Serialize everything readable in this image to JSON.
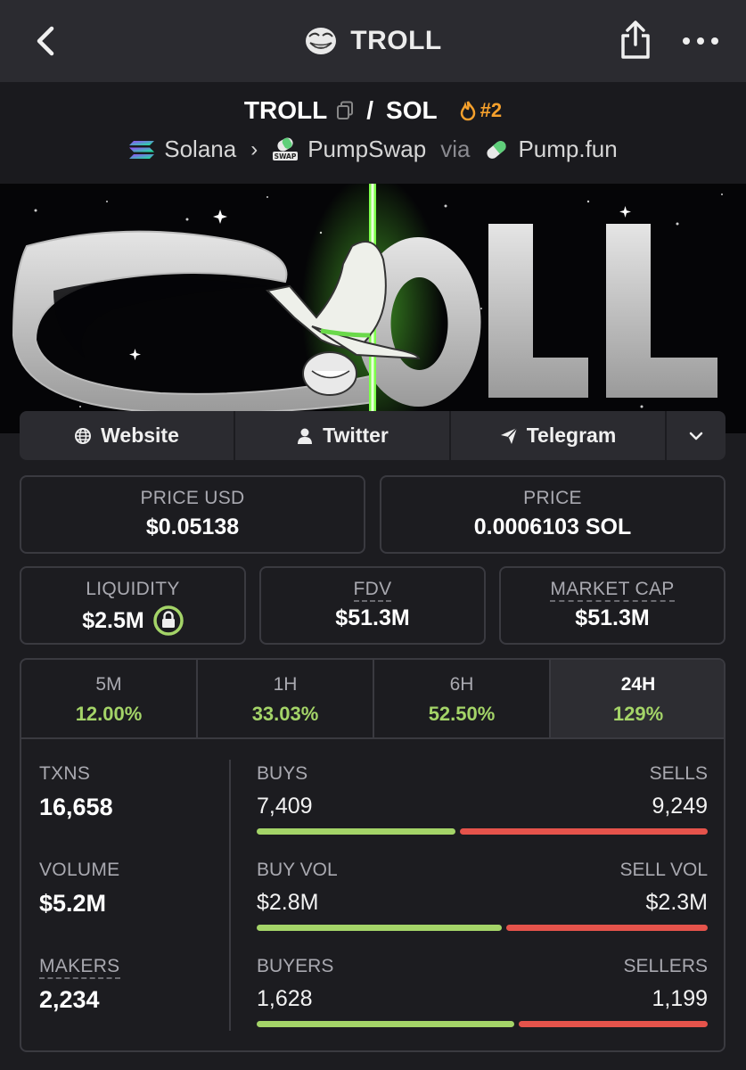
{
  "nav": {
    "title": "TROLL",
    "back_icon": "chevron-left-icon",
    "share_icon": "share-icon",
    "more_icon": "more-horizontal-icon"
  },
  "pair": {
    "base": "TROLL",
    "separator": "/",
    "quote": "SOL",
    "rank": "#2",
    "chain": "Solana",
    "dex": "PumpSwap",
    "via": "via",
    "launchpad": "Pump.fun"
  },
  "banner": {
    "text": "TROLL"
  },
  "links": {
    "website": "Website",
    "twitter": "Twitter",
    "telegram": "Telegram"
  },
  "stats": {
    "price_usd_label": "PRICE USD",
    "price_usd": "$0.05138",
    "price_label": "PRICE",
    "price": "0.0006103 SOL",
    "liquidity_label": "LIQUIDITY",
    "liquidity": "$2.5M",
    "fdv_label": "FDV",
    "fdv": "$51.3M",
    "mcap_label": "MARKET CAP",
    "mcap": "$51.3M"
  },
  "timeframes": [
    {
      "label": "5M",
      "change": "12.00%"
    },
    {
      "label": "1H",
      "change": "33.03%"
    },
    {
      "label": "6H",
      "change": "52.50%"
    },
    {
      "label": "24H",
      "change": "129%"
    }
  ],
  "txn": {
    "txns_label": "TXNS",
    "txns": "16,658",
    "volume_label": "VOLUME",
    "volume": "$5.2M",
    "makers_label": "MAKERS",
    "makers": "2,234",
    "buys_label": "BUYS",
    "buys": "7,409",
    "sells_label": "SELLS",
    "sells": "9,249",
    "buys_share": 0.445,
    "buyvol_label": "BUY VOL",
    "buyvol": "$2.8M",
    "sellvol_label": "SELL VOL",
    "sellvol": "$2.3M",
    "buyvol_share": 0.549,
    "buyers_label": "BUYERS",
    "buyers": "1,628",
    "sellers_label": "SELLERS",
    "sellers": "1,199",
    "buyers_share": 0.576
  },
  "colors": {
    "positive": "#a4d468",
    "negative": "#e5534b",
    "rank": "#f5a02c"
  }
}
